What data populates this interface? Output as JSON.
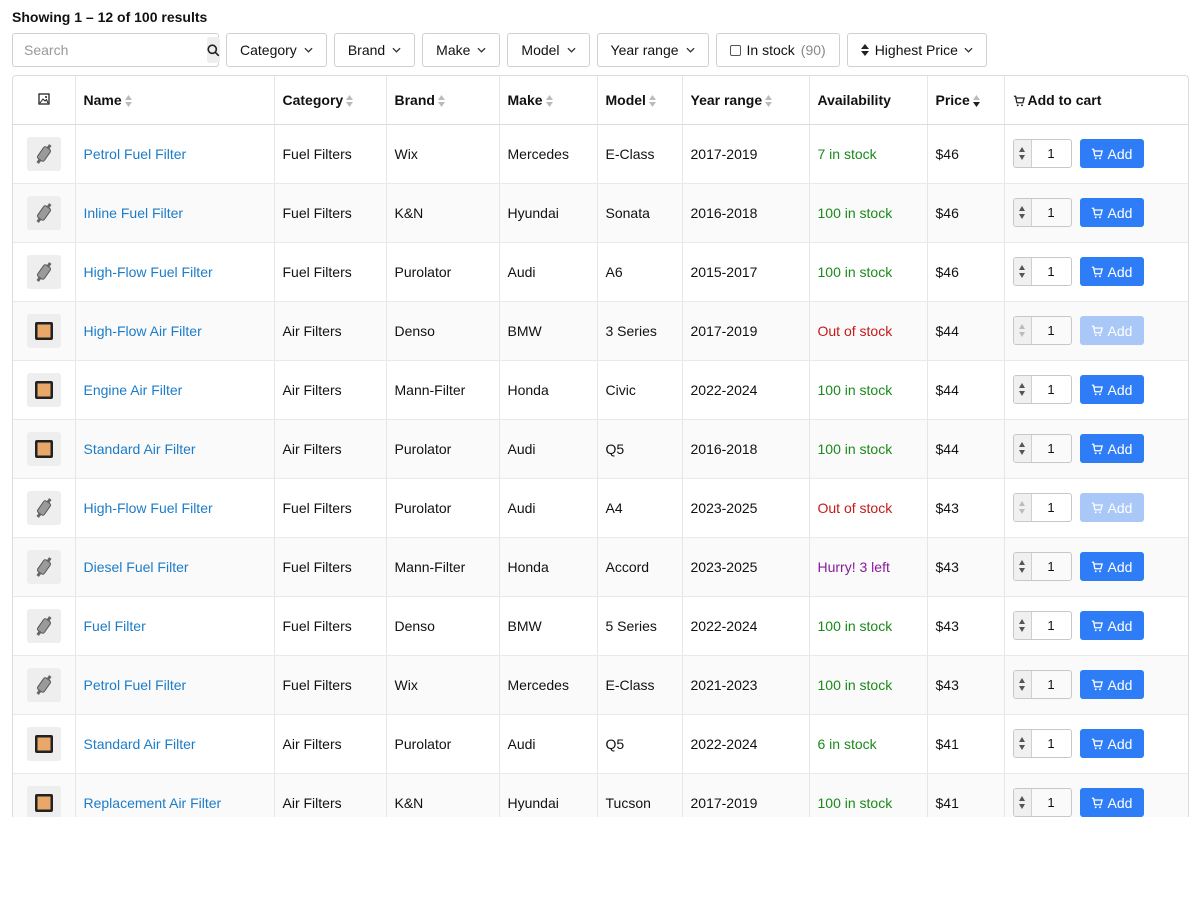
{
  "summary": "Showing 1 – 12 of 100 results",
  "search": {
    "placeholder": "Search"
  },
  "filters": {
    "category": "Category",
    "brand": "Brand",
    "make": "Make",
    "model": "Model",
    "year_range": "Year range",
    "in_stock_label": "In stock",
    "in_stock_count": "(90)",
    "sort": "Highest Price"
  },
  "columns": {
    "image": "image-icon",
    "name": "Name",
    "category": "Category",
    "brand": "Brand",
    "make": "Make",
    "model": "Model",
    "year_range": "Year range",
    "availability": "Availability",
    "price": "Price",
    "add_to_cart": "Add to cart"
  },
  "add_label": "Add",
  "colors": {
    "accent": "#2f7df6",
    "link": "#1c7cc7",
    "in_stock": "#1b8a1b",
    "out_of_stock": "#c41a1a",
    "low_stock": "#8a1a9c"
  },
  "rows": [
    {
      "name": "Petrol Fuel Filter",
      "category": "Fuel Filters",
      "brand": "Wix",
      "make": "Mercedes",
      "model": "E-Class",
      "year": "2017-2019",
      "availability": "7 in stock",
      "status": "green",
      "price": "$46",
      "qty": "1",
      "disabled": false,
      "thumb": "fuel-filter-icon"
    },
    {
      "name": "Inline Fuel Filter",
      "category": "Fuel Filters",
      "brand": "K&N",
      "make": "Hyundai",
      "model": "Sonata",
      "year": "2016-2018",
      "availability": "100 in stock",
      "status": "green",
      "price": "$46",
      "qty": "1",
      "disabled": false,
      "thumb": "fuel-filter-icon"
    },
    {
      "name": "High-Flow Fuel Filter",
      "category": "Fuel Filters",
      "brand": "Purolator",
      "make": "Audi",
      "model": "A6",
      "year": "2015-2017",
      "availability": "100 in stock",
      "status": "green",
      "price": "$46",
      "qty": "1",
      "disabled": false,
      "thumb": "fuel-filter-icon"
    },
    {
      "name": "High-Flow Air Filter",
      "category": "Air Filters",
      "brand": "Denso",
      "make": "BMW",
      "model": "3 Series",
      "year": "2017-2019",
      "availability": "Out of stock",
      "status": "red",
      "price": "$44",
      "qty": "1",
      "disabled": true,
      "thumb": "air-filter-icon"
    },
    {
      "name": "Engine Air Filter",
      "category": "Air Filters",
      "brand": "Mann-Filter",
      "make": "Honda",
      "model": "Civic",
      "year": "2022-2024",
      "availability": "100 in stock",
      "status": "green",
      "price": "$44",
      "qty": "1",
      "disabled": false,
      "thumb": "air-filter-icon"
    },
    {
      "name": "Standard Air Filter",
      "category": "Air Filters",
      "brand": "Purolator",
      "make": "Audi",
      "model": "Q5",
      "year": "2016-2018",
      "availability": "100 in stock",
      "status": "green",
      "price": "$44",
      "qty": "1",
      "disabled": false,
      "thumb": "air-filter-icon"
    },
    {
      "name": "High-Flow Fuel Filter",
      "category": "Fuel Filters",
      "brand": "Purolator",
      "make": "Audi",
      "model": "A4",
      "year": "2023-2025",
      "availability": "Out of stock",
      "status": "red",
      "price": "$43",
      "qty": "1",
      "disabled": true,
      "thumb": "fuel-filter-icon"
    },
    {
      "name": "Diesel Fuel Filter",
      "category": "Fuel Filters",
      "brand": "Mann-Filter",
      "make": "Honda",
      "model": "Accord",
      "year": "2023-2025",
      "availability": "Hurry! 3 left",
      "status": "purple",
      "price": "$43",
      "qty": "1",
      "disabled": false,
      "thumb": "fuel-filter-icon"
    },
    {
      "name": "Fuel Filter",
      "category": "Fuel Filters",
      "brand": "Denso",
      "make": "BMW",
      "model": "5 Series",
      "year": "2022-2024",
      "availability": "100 in stock",
      "status": "green",
      "price": "$43",
      "qty": "1",
      "disabled": false,
      "thumb": "fuel-filter-icon"
    },
    {
      "name": "Petrol Fuel Filter",
      "category": "Fuel Filters",
      "brand": "Wix",
      "make": "Mercedes",
      "model": "E-Class",
      "year": "2021-2023",
      "availability": "100 in stock",
      "status": "green",
      "price": "$43",
      "qty": "1",
      "disabled": false,
      "thumb": "fuel-filter-icon"
    },
    {
      "name": "Standard Air Filter",
      "category": "Air Filters",
      "brand": "Purolator",
      "make": "Audi",
      "model": "Q5",
      "year": "2022-2024",
      "availability": "6 in stock",
      "status": "green",
      "price": "$41",
      "qty": "1",
      "disabled": false,
      "thumb": "air-filter-icon"
    },
    {
      "name": "Replacement Air Filter",
      "category": "Air Filters",
      "brand": "K&N",
      "make": "Hyundai",
      "model": "Tucson",
      "year": "2017-2019",
      "availability": "100 in stock",
      "status": "green",
      "price": "$41",
      "qty": "1",
      "disabled": false,
      "thumb": "air-filter-icon"
    }
  ]
}
